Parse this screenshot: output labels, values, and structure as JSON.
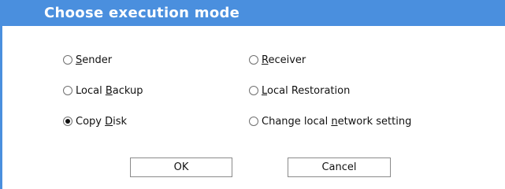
{
  "dialog": {
    "title": "Choose execution mode",
    "options": [
      {
        "pre": "",
        "key": "S",
        "post": "ender",
        "checked": false
      },
      {
        "pre": "",
        "key": "R",
        "post": "eceiver",
        "checked": false
      },
      {
        "pre": "Local ",
        "key": "B",
        "post": "ackup",
        "checked": false
      },
      {
        "pre": "",
        "key": "L",
        "post": "ocal Restoration",
        "checked": false
      },
      {
        "pre": "Copy ",
        "key": "D",
        "post": "isk",
        "checked": true
      },
      {
        "pre": "Change local ",
        "key": "n",
        "post": "etwork setting",
        "checked": false
      }
    ],
    "ok_label": "OK",
    "cancel_label": "Cancel"
  },
  "colors": {
    "title_bar": "#4a8fde",
    "title_text": "#ffffff"
  }
}
